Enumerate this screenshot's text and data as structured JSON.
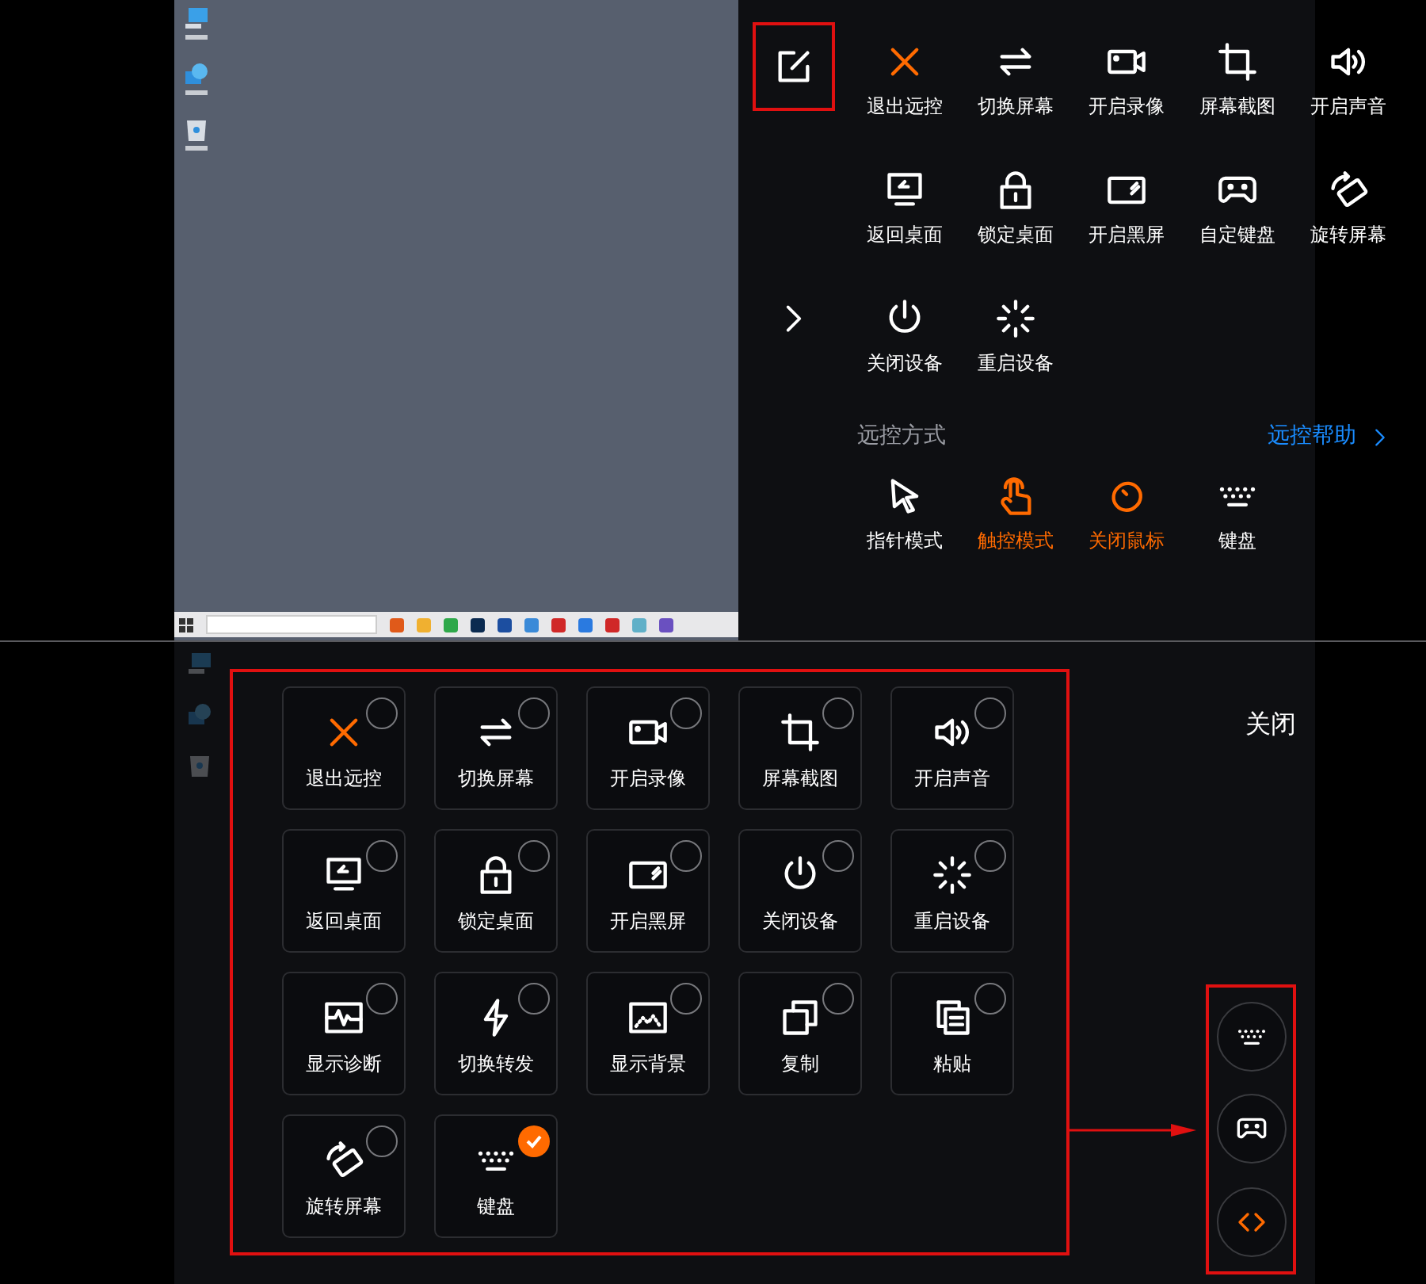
{
  "top_panel": {
    "actions": [
      {
        "label": "退出远控",
        "kind": "exit"
      },
      {
        "label": "切换屏幕",
        "kind": "switch"
      },
      {
        "label": "开启录像",
        "kind": "record"
      },
      {
        "label": "屏幕截图",
        "kind": "screenshot"
      },
      {
        "label": "开启声音",
        "kind": "sound"
      },
      {
        "label": "返回桌面",
        "kind": "desktop"
      },
      {
        "label": "锁定桌面",
        "kind": "lock"
      },
      {
        "label": "开启黑屏",
        "kind": "blackscreen"
      },
      {
        "label": "自定键盘",
        "kind": "gamepad"
      },
      {
        "label": "旋转屏幕",
        "kind": "rotate"
      },
      {
        "label": "关闭设备",
        "kind": "power"
      },
      {
        "label": "重启设备",
        "kind": "restart"
      }
    ],
    "mode_section": {
      "title": "远控方式",
      "help_link": "远控帮助",
      "modes": [
        {
          "label": "指针模式",
          "kind": "pointer",
          "active": false
        },
        {
          "label": "触控模式",
          "kind": "touch",
          "active": true
        },
        {
          "label": "关闭鼠标",
          "kind": "mouse",
          "active": true
        },
        {
          "label": "键盘",
          "kind": "keyboard",
          "active": false
        }
      ]
    }
  },
  "edit_panel": {
    "tiles": [
      {
        "label": "退出远控",
        "kind": "exit",
        "checked": false
      },
      {
        "label": "切换屏幕",
        "kind": "switch",
        "checked": false
      },
      {
        "label": "开启录像",
        "kind": "record",
        "checked": false
      },
      {
        "label": "屏幕截图",
        "kind": "screenshot",
        "checked": false
      },
      {
        "label": "开启声音",
        "kind": "sound",
        "checked": false
      },
      {
        "label": "返回桌面",
        "kind": "desktop",
        "checked": false
      },
      {
        "label": "锁定桌面",
        "kind": "lock",
        "checked": false
      },
      {
        "label": "开启黑屏",
        "kind": "blackscreen",
        "checked": false
      },
      {
        "label": "关闭设备",
        "kind": "power",
        "checked": false
      },
      {
        "label": "重启设备",
        "kind": "restart",
        "checked": false
      },
      {
        "label": "显示诊断",
        "kind": "diagnose",
        "checked": false
      },
      {
        "label": "切换转发",
        "kind": "relay",
        "checked": false
      },
      {
        "label": "显示背景",
        "kind": "background",
        "checked": false
      },
      {
        "label": "复制",
        "kind": "copy",
        "checked": false
      },
      {
        "label": "粘贴",
        "kind": "paste",
        "checked": false
      },
      {
        "label": "旋转屏幕",
        "kind": "rotate",
        "checked": false
      },
      {
        "label": "键盘",
        "kind": "keyboard",
        "checked": true
      }
    ],
    "close_button": "关闭",
    "floating_buttons": [
      {
        "kind": "keyboard",
        "active": false
      },
      {
        "kind": "gamepad",
        "active": false
      },
      {
        "kind": "code",
        "active": true
      }
    ]
  }
}
